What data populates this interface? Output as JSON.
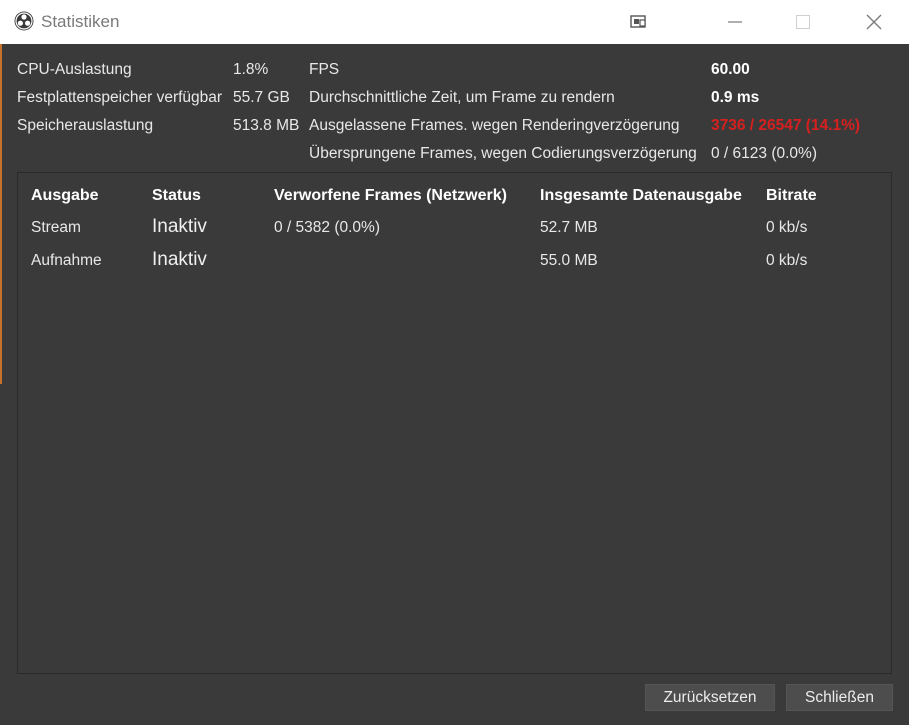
{
  "window": {
    "title": "Statistiken",
    "app_icon": "obs-logo-icon",
    "controls": [
      "pin-icon",
      "minimize-icon",
      "maximize-icon",
      "close-icon"
    ]
  },
  "stats": {
    "cpu_label": "CPU-Auslastung",
    "cpu_value": "1.8%",
    "disk_label": "Festplattenspeicher verfügbar",
    "disk_value": "55.7 GB",
    "memory_label": "Speicherauslastung",
    "memory_value": "513.8 MB",
    "fps_label": "FPS",
    "fps_value": "60.00",
    "render_time_label": "Durchschnittliche Zeit, um Frame zu rendern",
    "render_time_value": "0.9 ms",
    "missed_frames_label": "Ausgelassene Frames. wegen Renderingverzögerung",
    "missed_frames_value": "3736 / 26547 (14.1%)",
    "skipped_frames_label": "Übersprungene Frames, wegen Codierungsverzögerung",
    "skipped_frames_value": "0 / 6123 (0.0%)"
  },
  "outputs": {
    "headers": [
      "Ausgabe",
      "Status",
      "Verworfene Frames (Netzwerk)",
      "Insgesamte Datenausgabe",
      "Bitrate"
    ],
    "rows": [
      {
        "name": "Stream",
        "status": "Inaktiv",
        "dropped": "0 / 5382 (0.0%)",
        "total": "52.7 MB",
        "bitrate": "0 kb/s"
      },
      {
        "name": "Aufnahme",
        "status": "Inaktiv",
        "dropped": "",
        "total": "55.0 MB",
        "bitrate": "0 kb/s"
      }
    ]
  },
  "buttons": {
    "reset_label": "Zurücksetzen",
    "close_label": "Schließen"
  },
  "colors": {
    "background": "#3a3a3a",
    "warning_red": "#d62020",
    "titlebar": "#ffffff"
  }
}
